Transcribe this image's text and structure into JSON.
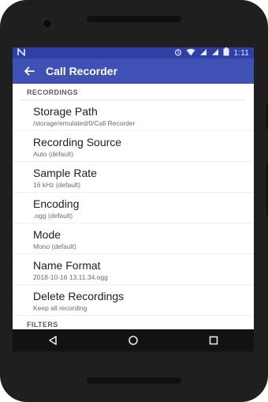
{
  "statusbar": {
    "time": "1:11",
    "icons": [
      "n-logo-icon",
      "alarm-icon",
      "wifi-icon",
      "signal-icon",
      "signal-icon",
      "battery-icon"
    ]
  },
  "appbar": {
    "title": "Call Recorder",
    "back_icon": "back-arrow-icon"
  },
  "sections": {
    "recordings": "RECORDINGS",
    "filters": "FILTERS"
  },
  "prefs": [
    {
      "title": "Storage Path",
      "summary": "/storage/emulated/0/Call Recorder"
    },
    {
      "title": "Recording Source",
      "summary": "Auto (default)"
    },
    {
      "title": "Sample Rate",
      "summary": "16 kHz (default)"
    },
    {
      "title": "Encoding",
      "summary": ".ogg (default)"
    },
    {
      "title": "Mode",
      "summary": "Mono (default)"
    },
    {
      "title": "Name Format",
      "summary": "2018-10-16 13.11.34.ogg"
    },
    {
      "title": "Delete Recordings",
      "summary": "Keep all recording"
    }
  ],
  "navbar": {
    "icons": [
      "back-triangle-icon",
      "home-circle-icon",
      "recents-square-icon"
    ]
  },
  "colors": {
    "appbar": "#3f51b5",
    "statusbar": "#2f3fa6"
  }
}
